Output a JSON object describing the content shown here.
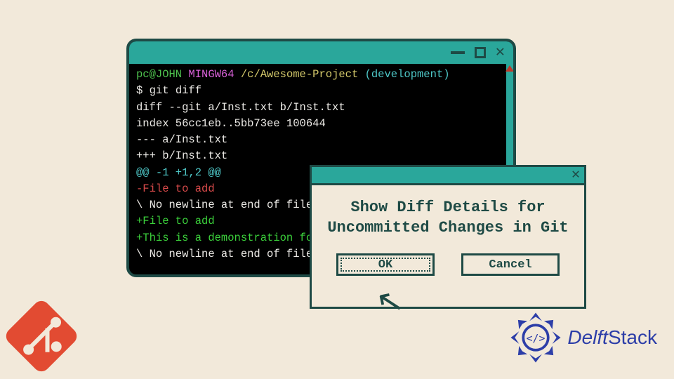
{
  "terminal": {
    "prompt_user": "pc@JOHN",
    "prompt_env": " MINGW64",
    "prompt_path": " /c/Awesome-Project",
    "prompt_branch": " (development)",
    "cmd_prefix": "$ ",
    "cmd": "git diff",
    "out1": "diff --git a/Inst.txt b/Inst.txt",
    "out2": "index 56cc1eb..5bb73ee 100644",
    "out3": "--- a/Inst.txt",
    "out4": "+++ b/Inst.txt",
    "hunk": "@@ -1 +1,2 @@",
    "del1": "-File to add",
    "nnl1": "\\ No newline at end of file",
    "add1": "+File to add",
    "add2": "+This is a demonstration for",
    "nnl2": "\\ No newline at end of file"
  },
  "dialog": {
    "message": "Show Diff Details for Uncommitted Changes in Git",
    "ok": "OK",
    "cancel": "Cancel"
  },
  "brand": {
    "name_italic": "Delft",
    "name_rest": "Stack"
  }
}
